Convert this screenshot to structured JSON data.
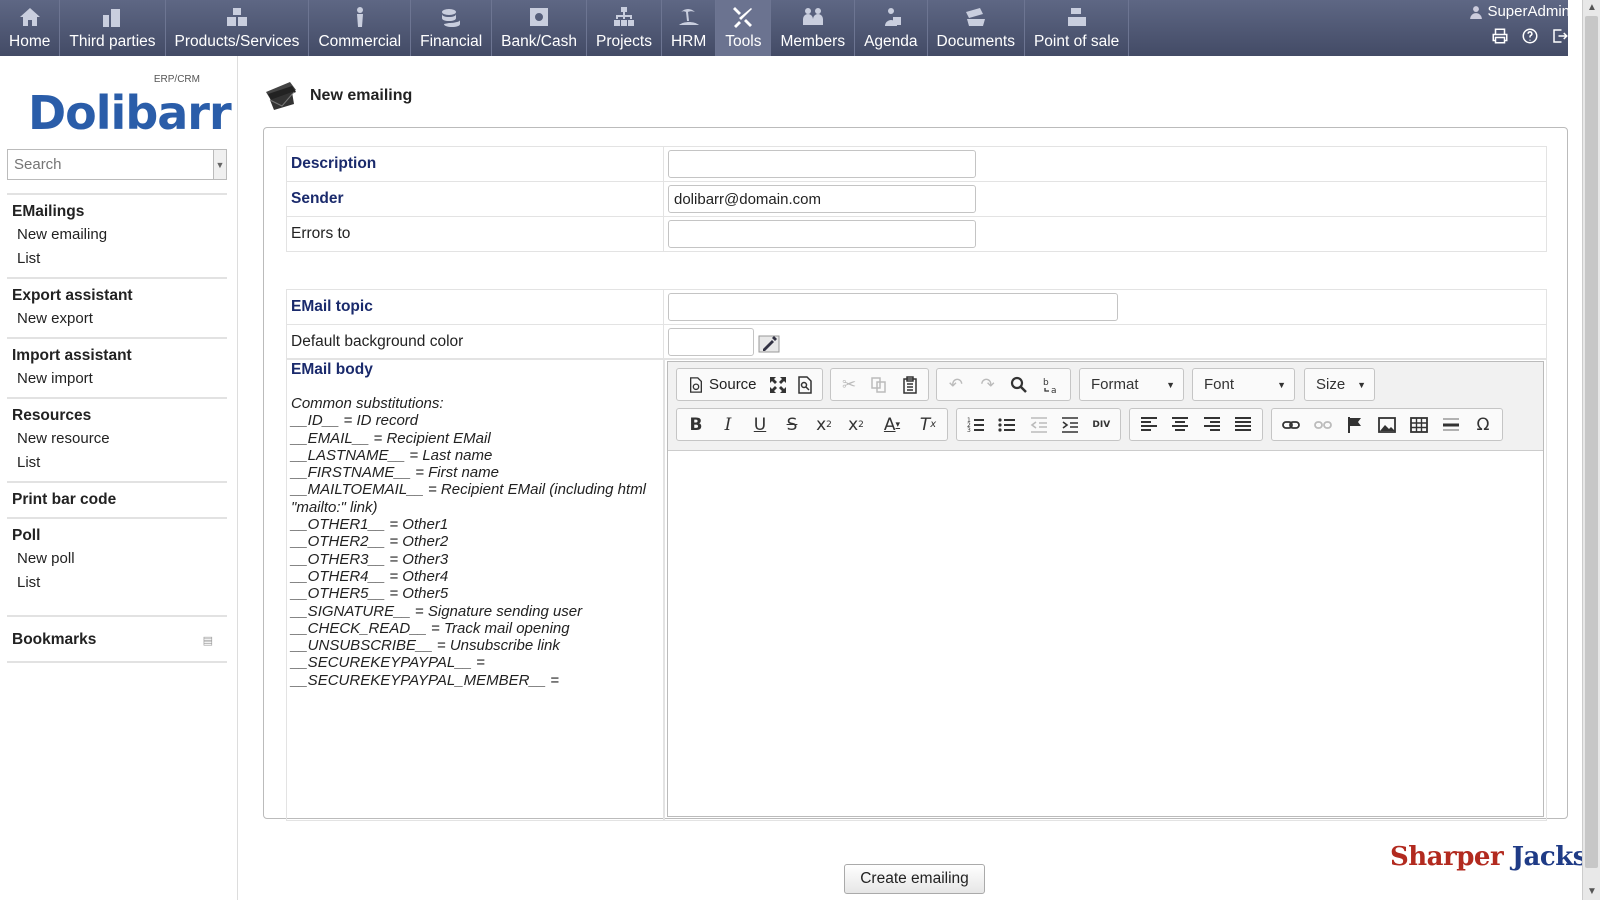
{
  "nav": {
    "tabs": [
      {
        "label": "Home",
        "icon": "home-icon"
      },
      {
        "label": "Third parties",
        "icon": "buildings-icon"
      },
      {
        "label": "Products/Services",
        "icon": "boxes-icon"
      },
      {
        "label": "Commercial",
        "icon": "person-icon"
      },
      {
        "label": "Financial",
        "icon": "coins-icon"
      },
      {
        "label": "Bank/Cash",
        "icon": "safe-icon"
      },
      {
        "label": "Projects",
        "icon": "org-chart-icon"
      },
      {
        "label": "HRM",
        "icon": "island-icon"
      },
      {
        "label": "Tools",
        "icon": "tools-icon"
      },
      {
        "label": "Members",
        "icon": "members-icon"
      },
      {
        "label": "Agenda",
        "icon": "agenda-icon"
      },
      {
        "label": "Documents",
        "icon": "folder-icon"
      },
      {
        "label": "Point of sale",
        "icon": "cash-register-icon"
      }
    ],
    "active_tab": "Tools",
    "user": "SuperAdmin"
  },
  "logo": {
    "erp_label": "ERP/CRM",
    "name": "Dolibarr"
  },
  "search": {
    "placeholder": "Search"
  },
  "menu": [
    {
      "title": "EMailings",
      "items": [
        "New emailing",
        "List"
      ]
    },
    {
      "title": "Export assistant",
      "items": [
        "New export"
      ]
    },
    {
      "title": "Import assistant",
      "items": [
        "New import"
      ]
    },
    {
      "title": "Resources",
      "items": [
        "New resource",
        "List"
      ]
    },
    {
      "title": "Print bar code",
      "items": []
    },
    {
      "title": "Poll",
      "items": [
        "New poll",
        "List"
      ]
    }
  ],
  "bookmarks": "Bookmarks",
  "page": {
    "title": "New emailing"
  },
  "form": {
    "description_label": "Description",
    "description_value": "",
    "sender_label": "Sender",
    "sender_value": "dolibarr@domain.com",
    "errors_label": "Errors to",
    "errors_value": "",
    "topic_label": "EMail topic",
    "topic_value": "",
    "bgcolor_label": "Default background color",
    "bgcolor_value": "",
    "body_label": "EMail body",
    "substitutions": "Common substitutions:\n__ID__ = ID record\n__EMAIL__ = Recipient EMail\n__LASTNAME__ = Last name\n__FIRSTNAME__ = First name\n__MAILTOEMAIL__ = Recipient EMail (including html \"mailto:\" link)\n__OTHER1__ = Other1\n__OTHER2__ = Other2\n__OTHER3__ = Other3\n__OTHER4__ = Other4\n__OTHER5__ = Other5\n__SIGNATURE__ = Signature sending user\n__CHECK_READ__ = Track mail opening\n__UNSUBSCRIBE__ = Unsubscribe link\n__SECUREKEYPAYPAL__ =\n__SECUREKEYPAYPAL_MEMBER__ ="
  },
  "editor": {
    "source_label": "Source",
    "format_label": "Format",
    "font_label": "Font",
    "size_label": "Size"
  },
  "create_button": "Create emailing",
  "watermark": {
    "part1": "Sharper",
    "part2": "Jacks"
  },
  "colors": {
    "nav": "#4b5370",
    "required_label": "#1a2a6c",
    "logo": "#2a5da9"
  }
}
